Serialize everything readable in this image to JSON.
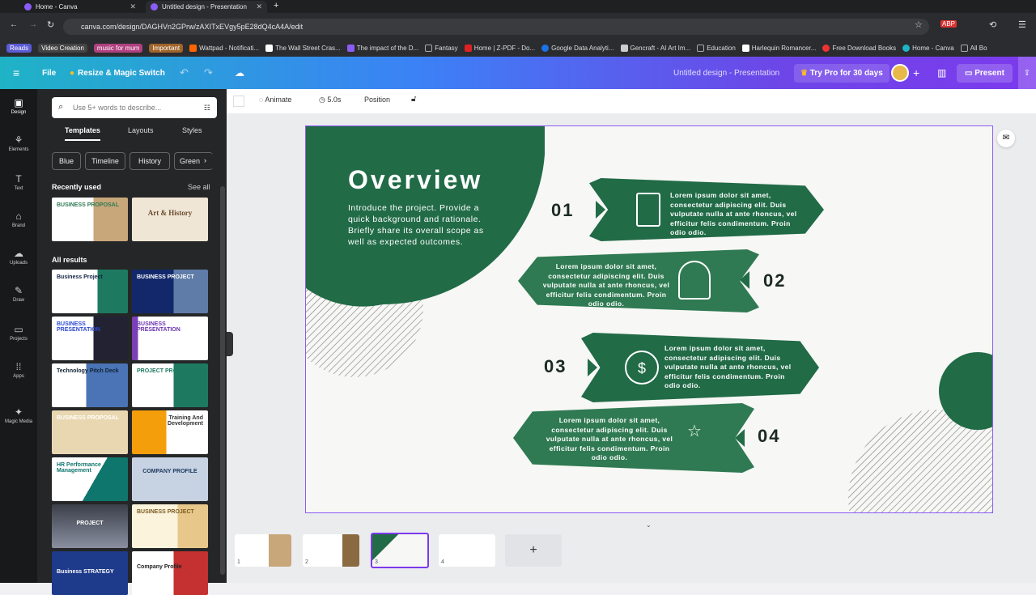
{
  "browser": {
    "tabs": [
      {
        "title": "Home - Canva"
      },
      {
        "title": "Untitled design - Presentation"
      }
    ],
    "url": "canva.com/design/DAGHVn2GPrw/zAXITxEVgy5pE28dQ4cA4A/edit",
    "bookmarks": [
      "Reads",
      "Video Creation",
      "music for mum",
      "Important",
      "Wattpad - Notificati...",
      "The Wall Street Cras...",
      "The impact of the D...",
      "Fantasy",
      "Home | Z-PDF - Do...",
      "Google Data Analyti...",
      "Gencraft - AI Art Im...",
      "Education",
      "Harlequin Romancer...",
      "Free Download Books",
      "Home - Canva",
      "All Bo"
    ]
  },
  "topbar": {
    "file": "File",
    "resize": "Resize & Magic Switch",
    "doc_title": "Untitled design - Presentation",
    "try_pro": "Try Pro for 30 days",
    "present": "Present"
  },
  "rail": [
    "Design",
    "Elements",
    "Text",
    "Brand",
    "Uploads",
    "Draw",
    "Projects",
    "Apps",
    "Magic Media"
  ],
  "panel": {
    "search_placeholder": "Use 5+ words to describe...",
    "tabs": [
      "Templates",
      "Layouts",
      "Styles"
    ],
    "chips": [
      "Blue",
      "Timeline",
      "History",
      "Green"
    ],
    "recent": "Recently used",
    "see_all": "See all",
    "all_results": "All results",
    "recent_thumbs": [
      "BUSINESS PROPOSAL",
      "Art & History"
    ],
    "results": [
      "Business Project",
      "BUSINESS PROJECT",
      "BUSINESS PRESENTATION",
      "BUSINESS PRESENTATION",
      "Technology Pitch Deck",
      "PROJECT PROPOSAL",
      "BUSINESS PROPOSAL",
      "Training And Development",
      "HR Performance Management",
      "COMPANY PROFILE",
      "PROJECT",
      "BUSINESS PROJECT",
      "Business STRATEGY",
      "Company Profile"
    ]
  },
  "toolbar": {
    "animate": "Animate",
    "duration": "5.0s",
    "position": "Position"
  },
  "slide": {
    "title": "Overview",
    "intro": "Introduce the project. Provide a quick background and rationale. Briefly share its overall scope as well as expected outcomes.",
    "items": [
      {
        "num": "01",
        "text": "Lorem ipsum dolor sit amet, consectetur adipiscing elit. Duis vulputate nulla at ante rhoncus, vel efficitur felis condimentum. Proin odio odio."
      },
      {
        "num": "02",
        "text": "Lorem ipsum dolor sit amet, consectetur adipiscing elit. Duis vulputate nulla at ante rhoncus, vel efficitur felis condimentum. Proin odio odio."
      },
      {
        "num": "03",
        "text": "Lorem ipsum dolor sit amet, consectetur adipiscing elit. Duis vulputate nulla at ante rhoncus, vel efficitur felis condimentum. Proin odio odio."
      },
      {
        "num": "04",
        "text": "Lorem ipsum dolor sit amet, consectetur adipiscing elit. Duis vulputate nulla at ante rhoncus, vel efficitur felis condimentum. Proin odio odio."
      }
    ]
  },
  "pages": [
    "1",
    "2",
    "3",
    "4"
  ],
  "add_page": "+",
  "colors": {
    "green": "#216b47",
    "green_light": "#2f7a52",
    "purple": "#7c3aed"
  }
}
